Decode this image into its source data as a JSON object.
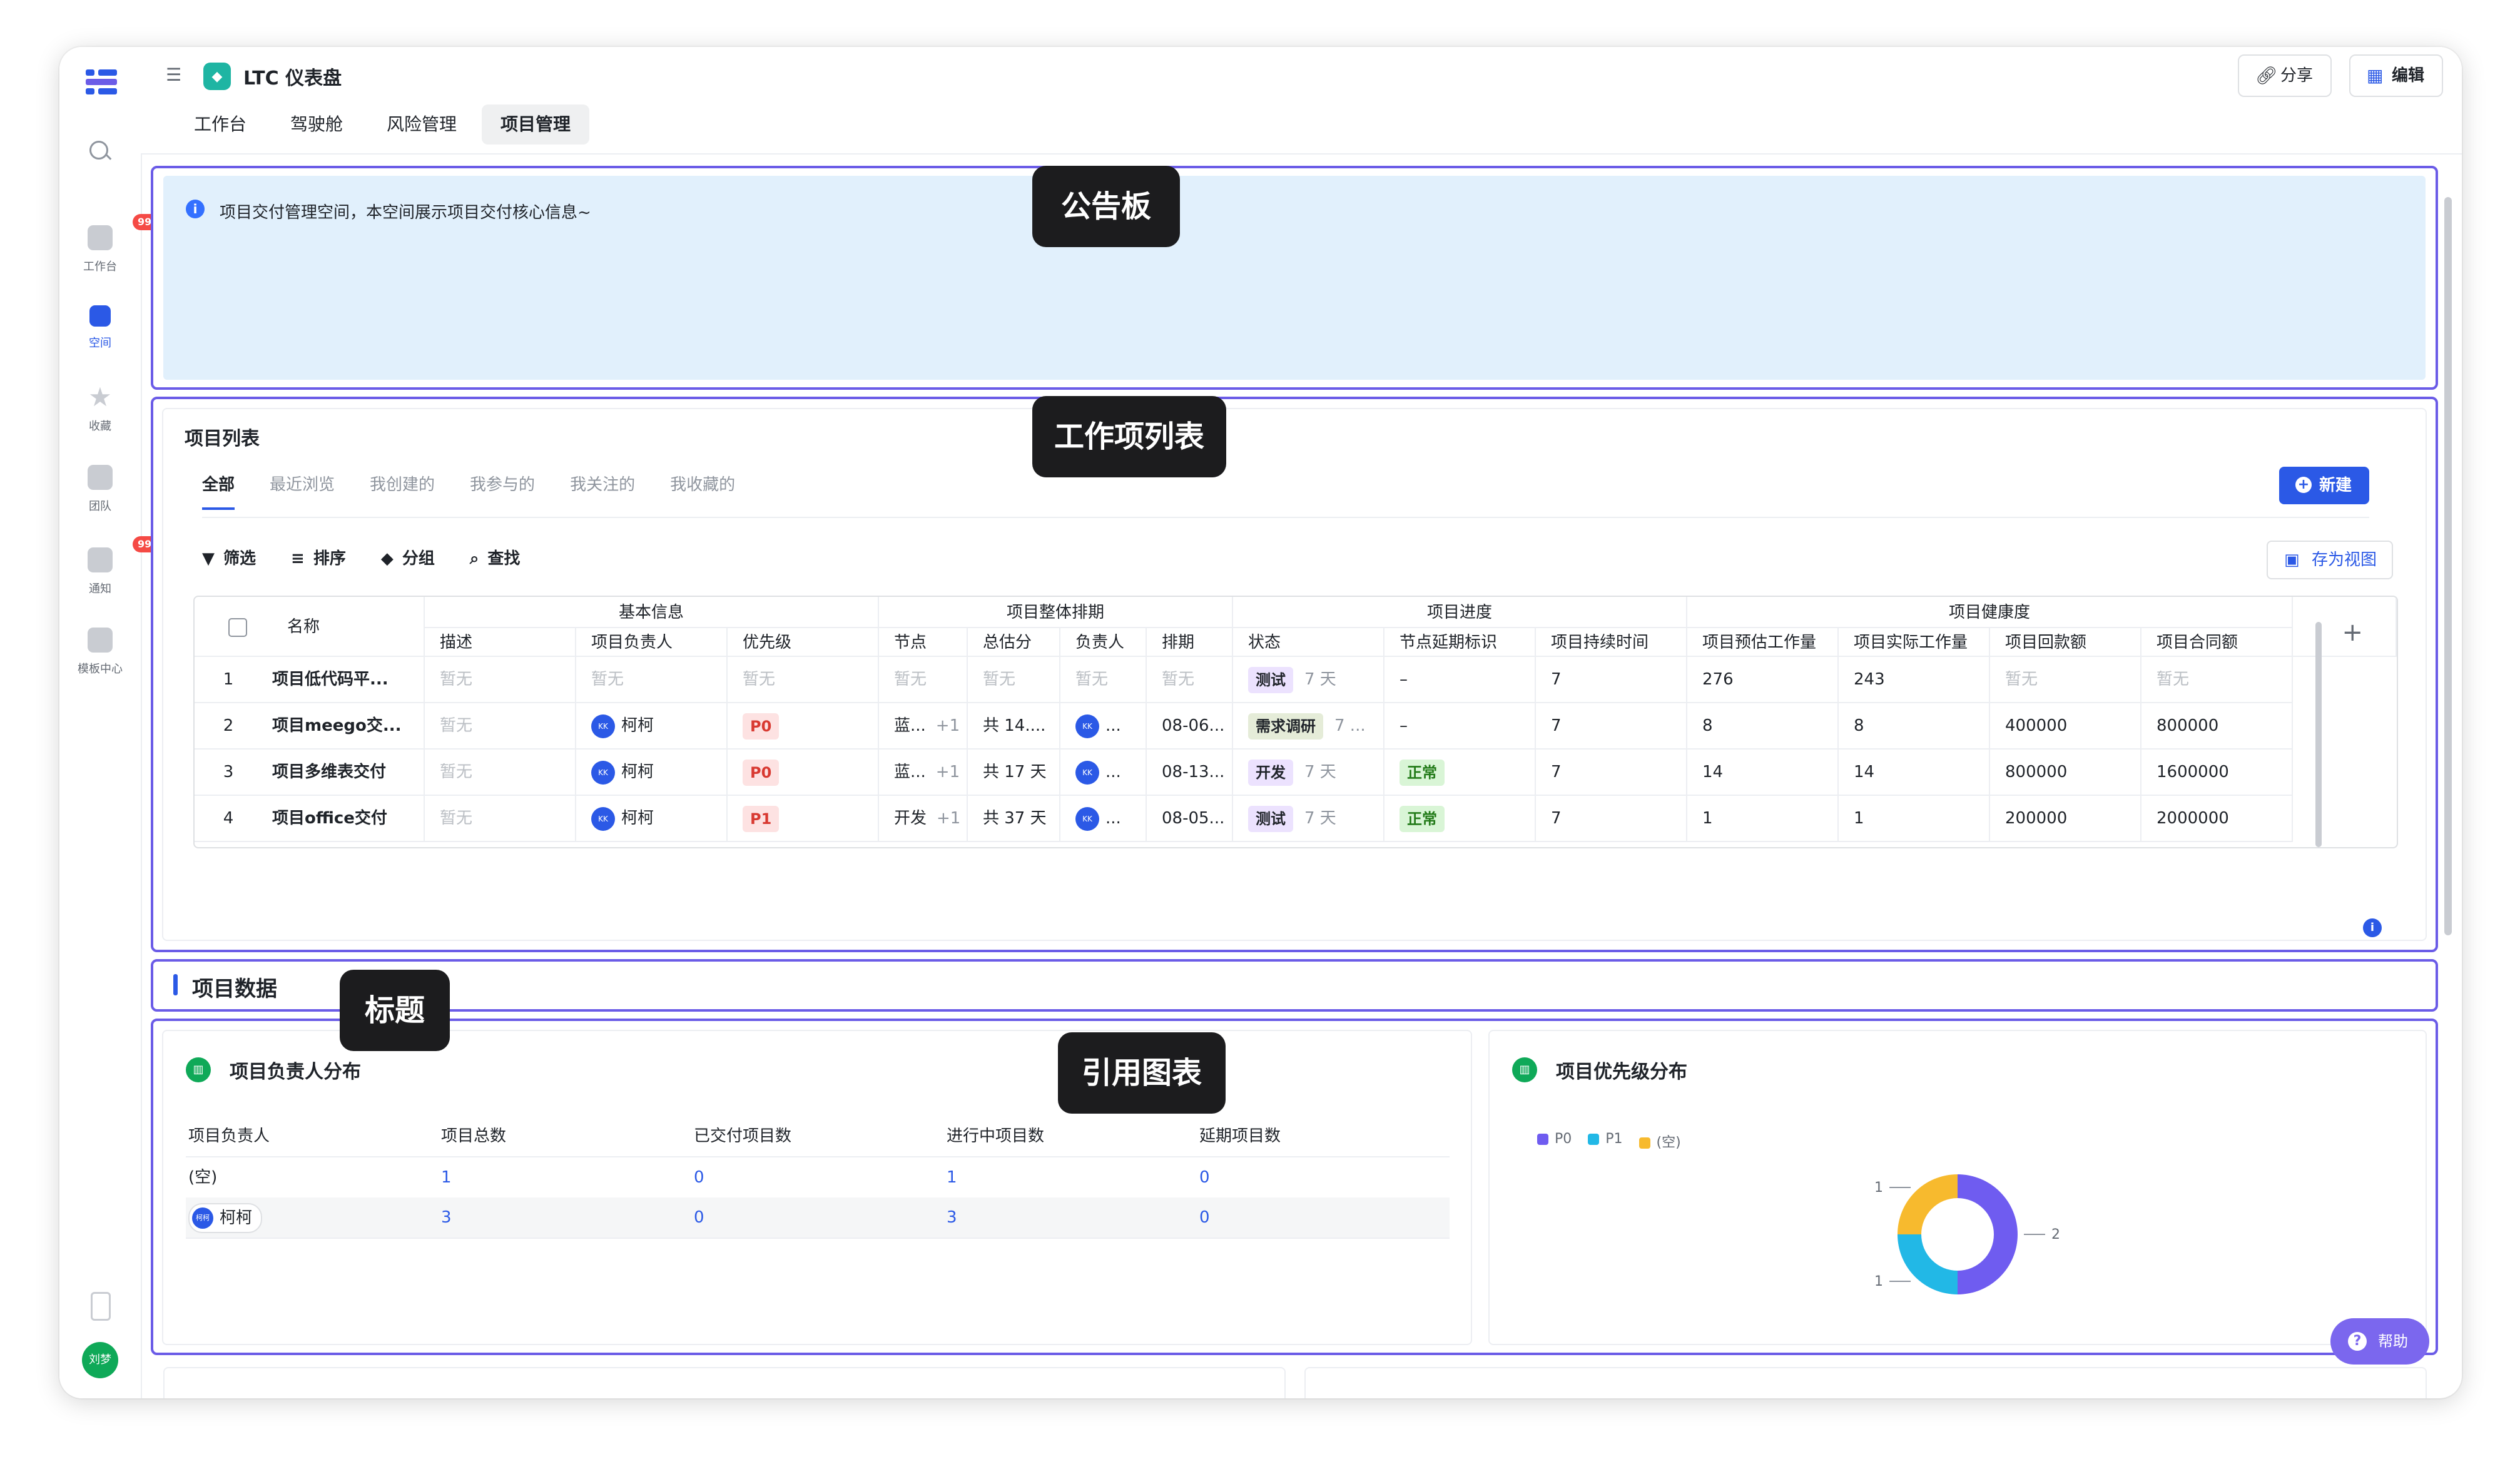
{
  "rail": {
    "items": [
      {
        "label": "",
        "badge": ""
      },
      {
        "label": "工作台",
        "badge": "99+"
      },
      {
        "label": "空间",
        "badge": ""
      },
      {
        "label": "收藏",
        "badge": ""
      },
      {
        "label": "团队",
        "badge": ""
      },
      {
        "label": "通知",
        "badge": "99+"
      },
      {
        "label": "模板中心",
        "badge": ""
      }
    ],
    "user_avatar": "刘梦"
  },
  "header": {
    "title": "LTC 仪表盘",
    "share_label": "分享",
    "edit_label": "编辑",
    "tabs": [
      "工作台",
      "驾驶舱",
      "风险管理",
      "项目管理"
    ],
    "active_tab": "项目管理"
  },
  "callouts": {
    "notice": "公告板",
    "worklist": "工作项列表",
    "title": "标题",
    "chart": "引用图表"
  },
  "notice": {
    "text": "项目交付管理空间，本空间展示项目交付核心信息~"
  },
  "project_list": {
    "title": "项目列表",
    "tabs": [
      "全部",
      "最近浏览",
      "我创建的",
      "我参与的",
      "我关注的",
      "我收藏的"
    ],
    "new_label": "新建",
    "toolbar": [
      "筛选",
      "排序",
      "分组",
      "查找"
    ],
    "save_view_label": "存为视图",
    "groups": [
      "基本信息",
      "项目整体排期",
      "项目进度",
      "项目健康度"
    ],
    "columns": [
      "名称",
      "描述",
      "项目负责人",
      "优先级",
      "节点",
      "总估分",
      "负责人",
      "排期",
      "状态",
      "节点延期标识",
      "项目持续时间",
      "项目预估工作量",
      "项目实际工作量",
      "项目回款额",
      "项目合同额"
    ],
    "rows": [
      {
        "no": "1",
        "name": "项目低代码平...",
        "desc": "暂无",
        "owner": "暂无",
        "priority": "暂无",
        "node": "暂无",
        "node_more": "",
        "score": "暂无",
        "assignee": "暂无",
        "schedule": "暂无",
        "status": "测试",
        "status_days": "7 天",
        "delay": "–",
        "duration": "7",
        "est": "276",
        "actual": "243",
        "paid": "暂无",
        "contract": "暂无"
      },
      {
        "no": "2",
        "name": "项目meego交...",
        "desc": "暂无",
        "owner": "柯柯",
        "priority": "P0",
        "node": "蓝...",
        "node_more": "+1",
        "score": "共 14....",
        "assignee": "...",
        "schedule": "08-06...",
        "status": "需求调研",
        "status_days": "7 ...",
        "delay": "–",
        "duration": "7",
        "est": "8",
        "actual": "8",
        "paid": "400000",
        "contract": "800000"
      },
      {
        "no": "3",
        "name": "项目多维表交付",
        "desc": "暂无",
        "owner": "柯柯",
        "priority": "P0",
        "node": "蓝...",
        "node_more": "+1",
        "score": "共 17 天",
        "assignee": "...",
        "schedule": "08-13...",
        "status": "开发",
        "status_days": "7 天",
        "delay": "正常",
        "duration": "7",
        "est": "14",
        "actual": "14",
        "paid": "800000",
        "contract": "1600000"
      },
      {
        "no": "4",
        "name": "项目office交付",
        "desc": "暂无",
        "owner": "柯柯",
        "priority": "P1",
        "node": "开发",
        "node_more": "+1",
        "score": "共 37 天",
        "assignee": "...",
        "schedule": "08-05...",
        "status": "测试",
        "status_days": "7 天",
        "delay": "正常",
        "duration": "7",
        "est": "1",
        "actual": "1",
        "paid": "200000",
        "contract": "2000000"
      }
    ]
  },
  "section_title": "项目数据",
  "owner_dist": {
    "title": "项目负责人分布",
    "columns": [
      "项目负责人",
      "项目总数",
      "已交付项目数",
      "进行中项目数",
      "延期项目数"
    ],
    "rows": [
      {
        "owner": "(空)",
        "total": "1",
        "delivered": "0",
        "ongoing": "1",
        "delayed": "0"
      },
      {
        "owner": "柯柯",
        "total": "3",
        "delivered": "0",
        "ongoing": "3",
        "delayed": "0"
      }
    ]
  },
  "chart_data": {
    "type": "pie",
    "title": "项目优先级分布",
    "categories": [
      "P0",
      "P1",
      "(空)"
    ],
    "values": [
      2,
      1,
      1
    ],
    "colors": [
      "#6f5cf0",
      "#22b8e6",
      "#f7ba2e"
    ],
    "legend": "top-left",
    "donut": true
  },
  "help_label": "帮助"
}
